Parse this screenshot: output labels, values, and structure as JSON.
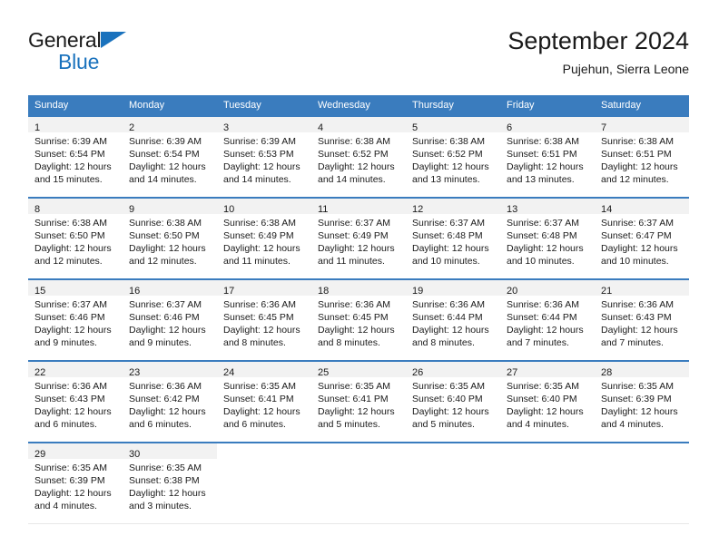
{
  "brand": {
    "line1": "General",
    "line2": "Blue",
    "triangle_color": "#1a72bd",
    "text_color": "#1a1a1a"
  },
  "header": {
    "title": "September 2024",
    "subtitle": "Pujehun, Sierra Leone"
  },
  "theme": {
    "header_row_bg": "#3a7cbe",
    "header_row_text": "#ffffff",
    "daynum_band_bg": "#f2f2f2",
    "row_divider": "#3a7cbe",
    "body_text": "#1a1a1a",
    "page_bg": "#ffffff"
  },
  "weekday_headers": [
    "Sunday",
    "Monday",
    "Tuesday",
    "Wednesday",
    "Thursday",
    "Friday",
    "Saturday"
  ],
  "weeks": [
    {
      "days": [
        {
          "day": "1",
          "sunrise": "Sunrise: 6:39 AM",
          "sunset": "Sunset: 6:54 PM",
          "daylight1": "Daylight: 12 hours",
          "daylight2": "and 15 minutes."
        },
        {
          "day": "2",
          "sunrise": "Sunrise: 6:39 AM",
          "sunset": "Sunset: 6:54 PM",
          "daylight1": "Daylight: 12 hours",
          "daylight2": "and 14 minutes."
        },
        {
          "day": "3",
          "sunrise": "Sunrise: 6:39 AM",
          "sunset": "Sunset: 6:53 PM",
          "daylight1": "Daylight: 12 hours",
          "daylight2": "and 14 minutes."
        },
        {
          "day": "4",
          "sunrise": "Sunrise: 6:38 AM",
          "sunset": "Sunset: 6:52 PM",
          "daylight1": "Daylight: 12 hours",
          "daylight2": "and 14 minutes."
        },
        {
          "day": "5",
          "sunrise": "Sunrise: 6:38 AM",
          "sunset": "Sunset: 6:52 PM",
          "daylight1": "Daylight: 12 hours",
          "daylight2": "and 13 minutes."
        },
        {
          "day": "6",
          "sunrise": "Sunrise: 6:38 AM",
          "sunset": "Sunset: 6:51 PM",
          "daylight1": "Daylight: 12 hours",
          "daylight2": "and 13 minutes."
        },
        {
          "day": "7",
          "sunrise": "Sunrise: 6:38 AM",
          "sunset": "Sunset: 6:51 PM",
          "daylight1": "Daylight: 12 hours",
          "daylight2": "and 12 minutes."
        }
      ]
    },
    {
      "days": [
        {
          "day": "8",
          "sunrise": "Sunrise: 6:38 AM",
          "sunset": "Sunset: 6:50 PM",
          "daylight1": "Daylight: 12 hours",
          "daylight2": "and 12 minutes."
        },
        {
          "day": "9",
          "sunrise": "Sunrise: 6:38 AM",
          "sunset": "Sunset: 6:50 PM",
          "daylight1": "Daylight: 12 hours",
          "daylight2": "and 12 minutes."
        },
        {
          "day": "10",
          "sunrise": "Sunrise: 6:38 AM",
          "sunset": "Sunset: 6:49 PM",
          "daylight1": "Daylight: 12 hours",
          "daylight2": "and 11 minutes."
        },
        {
          "day": "11",
          "sunrise": "Sunrise: 6:37 AM",
          "sunset": "Sunset: 6:49 PM",
          "daylight1": "Daylight: 12 hours",
          "daylight2": "and 11 minutes."
        },
        {
          "day": "12",
          "sunrise": "Sunrise: 6:37 AM",
          "sunset": "Sunset: 6:48 PM",
          "daylight1": "Daylight: 12 hours",
          "daylight2": "and 10 minutes."
        },
        {
          "day": "13",
          "sunrise": "Sunrise: 6:37 AM",
          "sunset": "Sunset: 6:48 PM",
          "daylight1": "Daylight: 12 hours",
          "daylight2": "and 10 minutes."
        },
        {
          "day": "14",
          "sunrise": "Sunrise: 6:37 AM",
          "sunset": "Sunset: 6:47 PM",
          "daylight1": "Daylight: 12 hours",
          "daylight2": "and 10 minutes."
        }
      ]
    },
    {
      "days": [
        {
          "day": "15",
          "sunrise": "Sunrise: 6:37 AM",
          "sunset": "Sunset: 6:46 PM",
          "daylight1": "Daylight: 12 hours",
          "daylight2": "and 9 minutes."
        },
        {
          "day": "16",
          "sunrise": "Sunrise: 6:37 AM",
          "sunset": "Sunset: 6:46 PM",
          "daylight1": "Daylight: 12 hours",
          "daylight2": "and 9 minutes."
        },
        {
          "day": "17",
          "sunrise": "Sunrise: 6:36 AM",
          "sunset": "Sunset: 6:45 PM",
          "daylight1": "Daylight: 12 hours",
          "daylight2": "and 8 minutes."
        },
        {
          "day": "18",
          "sunrise": "Sunrise: 6:36 AM",
          "sunset": "Sunset: 6:45 PM",
          "daylight1": "Daylight: 12 hours",
          "daylight2": "and 8 minutes."
        },
        {
          "day": "19",
          "sunrise": "Sunrise: 6:36 AM",
          "sunset": "Sunset: 6:44 PM",
          "daylight1": "Daylight: 12 hours",
          "daylight2": "and 8 minutes."
        },
        {
          "day": "20",
          "sunrise": "Sunrise: 6:36 AM",
          "sunset": "Sunset: 6:44 PM",
          "daylight1": "Daylight: 12 hours",
          "daylight2": "and 7 minutes."
        },
        {
          "day": "21",
          "sunrise": "Sunrise: 6:36 AM",
          "sunset": "Sunset: 6:43 PM",
          "daylight1": "Daylight: 12 hours",
          "daylight2": "and 7 minutes."
        }
      ]
    },
    {
      "days": [
        {
          "day": "22",
          "sunrise": "Sunrise: 6:36 AM",
          "sunset": "Sunset: 6:43 PM",
          "daylight1": "Daylight: 12 hours",
          "daylight2": "and 6 minutes."
        },
        {
          "day": "23",
          "sunrise": "Sunrise: 6:36 AM",
          "sunset": "Sunset: 6:42 PM",
          "daylight1": "Daylight: 12 hours",
          "daylight2": "and 6 minutes."
        },
        {
          "day": "24",
          "sunrise": "Sunrise: 6:35 AM",
          "sunset": "Sunset: 6:41 PM",
          "daylight1": "Daylight: 12 hours",
          "daylight2": "and 6 minutes."
        },
        {
          "day": "25",
          "sunrise": "Sunrise: 6:35 AM",
          "sunset": "Sunset: 6:41 PM",
          "daylight1": "Daylight: 12 hours",
          "daylight2": "and 5 minutes."
        },
        {
          "day": "26",
          "sunrise": "Sunrise: 6:35 AM",
          "sunset": "Sunset: 6:40 PM",
          "daylight1": "Daylight: 12 hours",
          "daylight2": "and 5 minutes."
        },
        {
          "day": "27",
          "sunrise": "Sunrise: 6:35 AM",
          "sunset": "Sunset: 6:40 PM",
          "daylight1": "Daylight: 12 hours",
          "daylight2": "and 4 minutes."
        },
        {
          "day": "28",
          "sunrise": "Sunrise: 6:35 AM",
          "sunset": "Sunset: 6:39 PM",
          "daylight1": "Daylight: 12 hours",
          "daylight2": "and 4 minutes."
        }
      ]
    },
    {
      "days": [
        {
          "day": "29",
          "sunrise": "Sunrise: 6:35 AM",
          "sunset": "Sunset: 6:39 PM",
          "daylight1": "Daylight: 12 hours",
          "daylight2": "and 4 minutes."
        },
        {
          "day": "30",
          "sunrise": "Sunrise: 6:35 AM",
          "sunset": "Sunset: 6:38 PM",
          "daylight1": "Daylight: 12 hours",
          "daylight2": "and 3 minutes."
        },
        {
          "day": "",
          "sunrise": "",
          "sunset": "",
          "daylight1": "",
          "daylight2": ""
        },
        {
          "day": "",
          "sunrise": "",
          "sunset": "",
          "daylight1": "",
          "daylight2": ""
        },
        {
          "day": "",
          "sunrise": "",
          "sunset": "",
          "daylight1": "",
          "daylight2": ""
        },
        {
          "day": "",
          "sunrise": "",
          "sunset": "",
          "daylight1": "",
          "daylight2": ""
        },
        {
          "day": "",
          "sunrise": "",
          "sunset": "",
          "daylight1": "",
          "daylight2": ""
        }
      ]
    }
  ]
}
